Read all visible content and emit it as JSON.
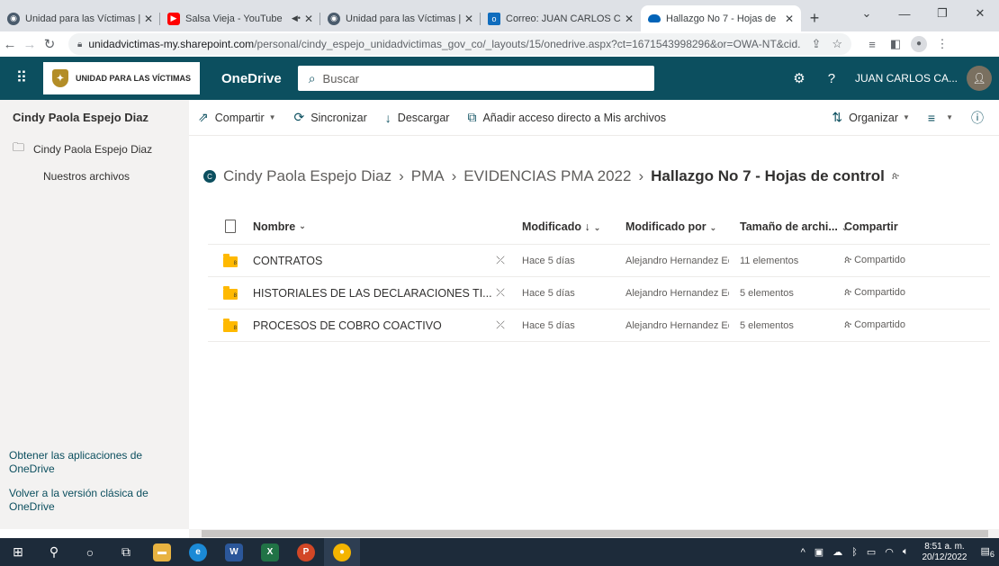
{
  "browser": {
    "tabs": [
      {
        "title": "Unidad para las Víctimas |",
        "icon": "uv-favicon",
        "color": "#4a5b6c"
      },
      {
        "title": "Salsa Vieja - YouTube",
        "icon": "youtube-favicon",
        "color": "#ff0000",
        "audio": "◀•"
      },
      {
        "title": "Unidad para las Víctimas |",
        "icon": "uv-favicon",
        "color": "#4a5b6c"
      },
      {
        "title": "Correo: JUAN CARLOS CA",
        "icon": "outlook-favicon",
        "color": "#0f6cbd"
      },
      {
        "title": "Hallazgo No 7 - Hojas de",
        "icon": "onedrive-favicon",
        "color": "#0364b8"
      }
    ],
    "url_host": "unidadvictimas-my.sharepoint.com",
    "url_path": "/personal/cindy_espejo_unidadvictimas_gov_co/_layouts/15/onedrive.aspx?ct=1671543998296&or=OWA-NT&cid..."
  },
  "suite": {
    "org_name": "UNIDAD PARA LAS VÍCTIMAS",
    "app_name": "OneDrive",
    "search_placeholder": "Buscar",
    "user_name": "JUAN CARLOS CA...",
    "help_icon": "?"
  },
  "sidebar": {
    "owner": "Cindy Paola Espejo Diaz",
    "items": [
      {
        "label": "Cindy Paola Espejo Diaz"
      },
      {
        "label": "Nuestros archivos"
      }
    ],
    "links": [
      "Obtener las aplicaciones de OneDrive",
      "Volver a la versión clásica de OneDrive"
    ]
  },
  "commands": {
    "share": "Compartir",
    "sync": "Sincronizar",
    "download": "Descargar",
    "shortcut": "Añadir acceso directo a Mis archivos",
    "organize": "Organizar"
  },
  "breadcrumb": {
    "badge": "C",
    "items": [
      "Cindy Paola Espejo Diaz",
      "PMA",
      "EVIDENCIAS PMA 2022"
    ],
    "current": "Hallazgo No 7 - Hojas de control"
  },
  "list": {
    "columns": {
      "name": "Nombre",
      "modified": "Modificado ↓",
      "modified_by": "Modificado por",
      "size": "Tamaño de archi...",
      "sharing": "Compartir"
    },
    "rows": [
      {
        "name": "CONTRATOS",
        "modified": "Hace 5 días",
        "modified_by": "Alejandro Hernandez Eche",
        "size": "11 elementos",
        "sharing": "Compartido",
        "count": "8"
      },
      {
        "name": "HISTORIALES DE LAS DECLARACIONES TI...",
        "modified": "Hace 5 días",
        "modified_by": "Alejandro Hernandez Eche",
        "size": "5 elementos",
        "sharing": "Compartido",
        "count": "8"
      },
      {
        "name": "PROCESOS DE COBRO COACTIVO",
        "modified": "Hace 5 días",
        "modified_by": "Alejandro Hernandez Eche",
        "size": "5 elementos",
        "sharing": "Compartido",
        "count": "8"
      }
    ]
  },
  "taskbar": {
    "time": "8:51 a. m.",
    "date": "20/12/2022",
    "notifications": "6"
  }
}
